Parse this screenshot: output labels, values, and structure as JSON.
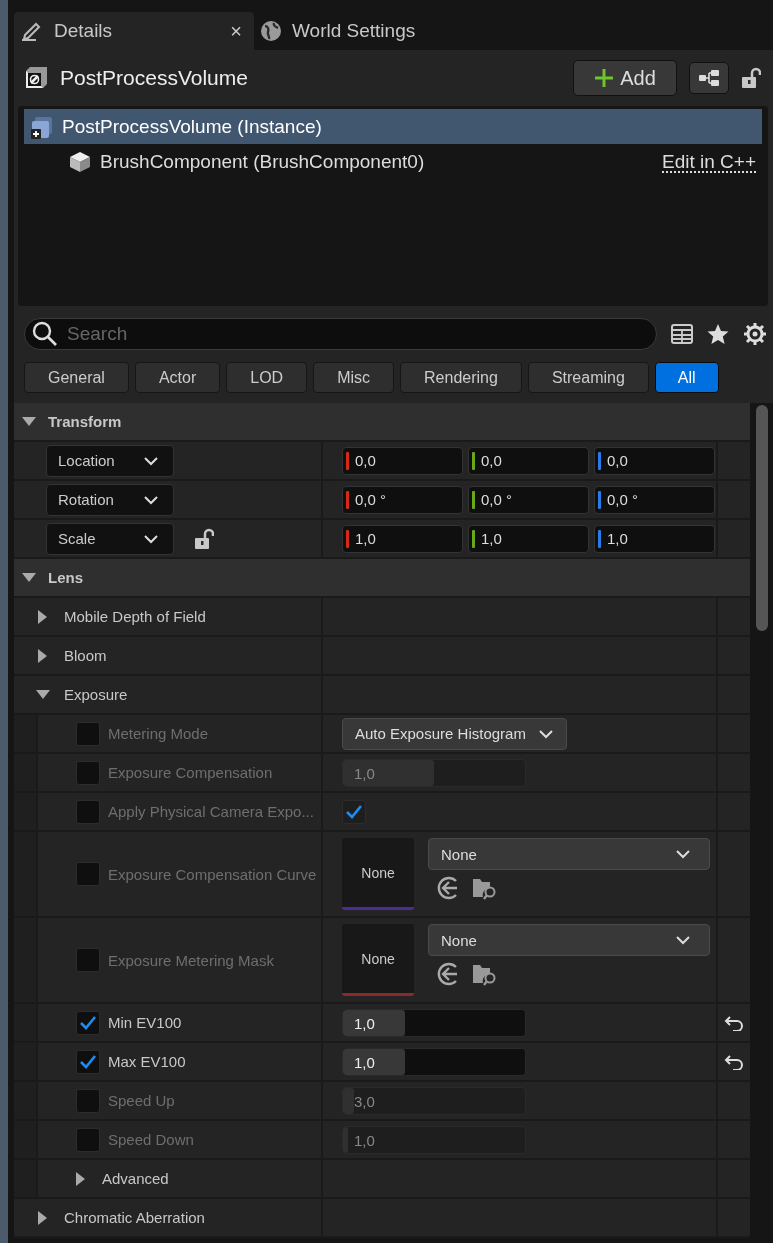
{
  "tabs": [
    {
      "label": "Details",
      "selected": true,
      "close": "×",
      "kind": "details"
    },
    {
      "label": "World Settings",
      "selected": false,
      "kind": "world"
    }
  ],
  "actor": {
    "name": "PostProcessVolume",
    "add_button": "Add"
  },
  "components": [
    {
      "label": "PostProcessVolume (Instance)",
      "selected": true,
      "kind": "actor"
    },
    {
      "label": "BrushComponent (BrushComponent0)",
      "selected": false,
      "kind": "brush",
      "action": "Edit in C++"
    }
  ],
  "search": {
    "placeholder": "Search"
  },
  "filters": [
    {
      "label": "General",
      "selected": false
    },
    {
      "label": "Actor",
      "selected": false
    },
    {
      "label": "LOD",
      "selected": false
    },
    {
      "label": "Misc",
      "selected": false
    },
    {
      "label": "Rendering",
      "selected": false
    },
    {
      "label": "Streaming",
      "selected": false
    },
    {
      "label": "All",
      "selected": true
    }
  ],
  "properties": [
    {
      "kind": "section",
      "label": "Transform",
      "expanded": true,
      "children": [
        {
          "kind": "vector",
          "label": "Location",
          "values": [
            "0,0",
            "0,0",
            "0,0"
          ]
        },
        {
          "kind": "vector",
          "label": "Rotation",
          "values": [
            "0,0 °",
            "0,0 °",
            "0,0 °"
          ]
        },
        {
          "kind": "vector",
          "label": "Scale",
          "values": [
            "1,0",
            "1,0",
            "1,0"
          ],
          "has_lock": true
        }
      ]
    },
    {
      "kind": "section",
      "label": "Lens",
      "expanded": true,
      "children": [
        {
          "kind": "group",
          "label": "Mobile Depth of Field",
          "expanded": false
        },
        {
          "kind": "group",
          "label": "Bloom",
          "expanded": false
        },
        {
          "kind": "group",
          "label": "Exposure",
          "expanded": true,
          "children": [
            {
              "kind": "enum",
              "label": "Metering Mode",
              "override": false,
              "value": "Auto Exposure Histogram"
            },
            {
              "kind": "number",
              "label": "Exposure Compensation",
              "override": false,
              "value": "1,0",
              "level": 0.5
            },
            {
              "kind": "bool",
              "label": "Apply Physical Camera Expo...",
              "override": false,
              "checked": true
            },
            {
              "kind": "asset",
              "label": "Exposure Compensation Curve",
              "override": false,
              "thumbnail": "None",
              "value": "None",
              "color": "#4b2d96"
            },
            {
              "kind": "asset",
              "label": "Exposure Metering Mask",
              "override": false,
              "thumbnail": "None",
              "value": "None",
              "color": "#8c2a2a"
            },
            {
              "kind": "number",
              "label": "Min EV100",
              "override": true,
              "value": "1,0",
              "level": 0.34,
              "reset": true
            },
            {
              "kind": "number",
              "label": "Max EV100",
              "override": true,
              "value": "1,0",
              "level": 0.34,
              "reset": true
            },
            {
              "kind": "number",
              "label": "Speed Up",
              "override": false,
              "value": "3,0",
              "level": 0.06
            },
            {
              "kind": "number",
              "label": "Speed Down",
              "override": false,
              "value": "1,0",
              "level": 0.03
            },
            {
              "kind": "group",
              "label": "Advanced",
              "expanded": false
            }
          ]
        },
        {
          "kind": "group",
          "label": "Chromatic Aberration",
          "expanded": false
        }
      ]
    }
  ]
}
